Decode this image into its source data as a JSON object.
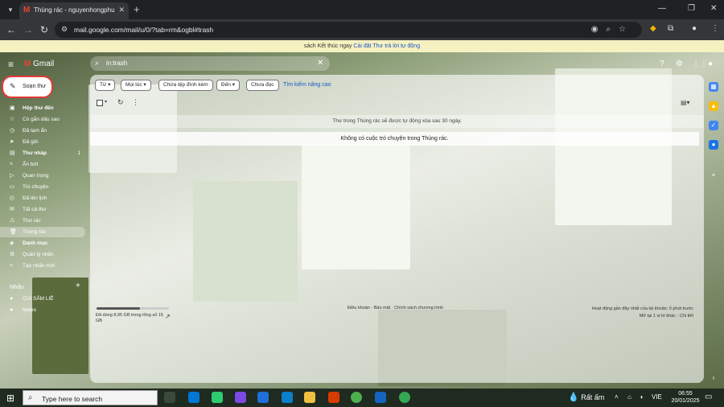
{
  "browser": {
    "tab_title": "Thùng rác - nguyenhongphuc2",
    "url": "mail.google.com/mail/u/0/?tab=rm&ogbl#trash"
  },
  "banner": {
    "text": "sách Kết thúc ngay",
    "link": "Cài đặt Thư trả lời tự động"
  },
  "header": {
    "app_name": "Gmail",
    "search_value": "in:trash"
  },
  "sidebar": {
    "compose_label": "Soạn thư",
    "items": [
      {
        "label": "Hộp thư đến",
        "icon": "inbox-icon",
        "count": ""
      },
      {
        "label": "Có gắn dấu sao",
        "icon": "star-icon",
        "count": ""
      },
      {
        "label": "Đã tạm ẩn",
        "icon": "clock-icon",
        "count": ""
      },
      {
        "label": "Đã gửi",
        "icon": "send-icon",
        "count": ""
      },
      {
        "label": "Thư nháp",
        "icon": "draft-icon",
        "count": "1"
      },
      {
        "label": "Ẩn bớt",
        "icon": "chevron-up-icon",
        "count": ""
      },
      {
        "label": "Quan trọng",
        "icon": "important-icon",
        "count": ""
      },
      {
        "label": "Trò chuyện",
        "icon": "chat-icon",
        "count": ""
      },
      {
        "label": "Đã lên lịch",
        "icon": "scheduled-icon",
        "count": ""
      },
      {
        "label": "Tất cả thư",
        "icon": "all-mail-icon",
        "count": ""
      },
      {
        "label": "Thư rác",
        "icon": "spam-icon",
        "count": ""
      },
      {
        "label": "Thùng rác",
        "icon": "trash-icon",
        "count": ""
      },
      {
        "label": "Danh mục",
        "icon": "category-icon",
        "count": ""
      },
      {
        "label": "Quản lý nhãn",
        "icon": "gear-icon",
        "count": ""
      },
      {
        "label": "Tạo nhãn mới",
        "icon": "plus-icon",
        "count": ""
      }
    ],
    "labels_heading": "Nhãn",
    "labels": [
      {
        "label": "CUI SẮM LIỀ"
      },
      {
        "label": "Notes"
      }
    ]
  },
  "filters": {
    "chips": [
      "Từ",
      "Mọi lúc",
      "Chứa tệp đính kèm",
      "Đến",
      "Chưa đọc"
    ],
    "advanced_search": "Tìm kiếm nâng cao"
  },
  "main": {
    "trash_note": "Thư trong Thùng rác sẽ được tự động xóa sau 30 ngày.",
    "empty_message": "Không có cuộc trò chuyện trong Thùng rác."
  },
  "footer": {
    "storage": "Đã dùng 8,95 GB trong tổng số 15 GB",
    "storage_fraction": 0.6,
    "terms": "Điều khoản · Bảo mật · Chính sách chương trình",
    "activity_line1": "Hoạt động gần đây nhất của tài khoản: 0 phút trước",
    "activity_line2": "Mở tại 1 vị trí khác · Chi tiết"
  },
  "taskbar": {
    "search_placeholder": "Type here to search",
    "weather": "Rất ấm",
    "language": "VIE",
    "time": "06:55",
    "date": "20/01/2025"
  }
}
